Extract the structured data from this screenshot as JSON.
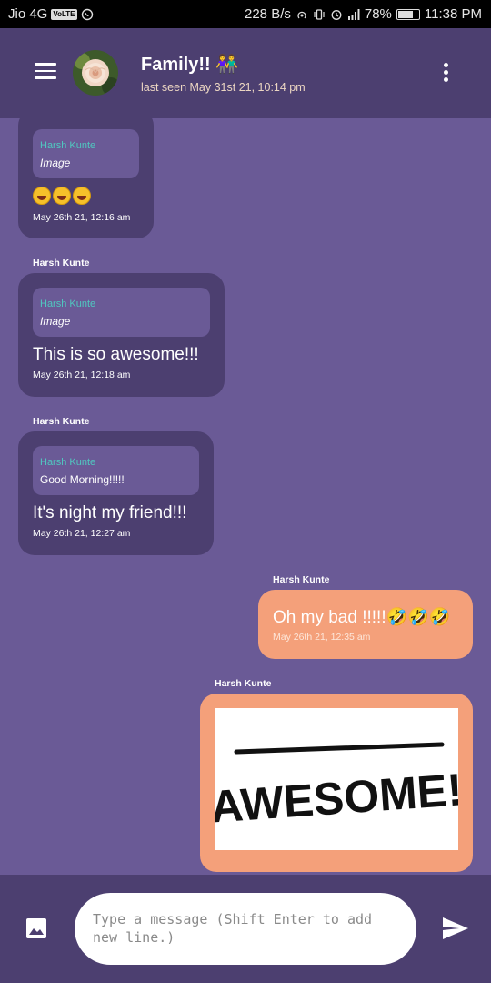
{
  "status_bar": {
    "carrier": "Jio 4G",
    "volte": "VoLTE",
    "speed": "228 B/s",
    "battery": "78%",
    "battery_level": 0.78,
    "time": "11:38 PM"
  },
  "header": {
    "title": "Family!! 👫",
    "subtitle": "last seen May 31st 21, 10:14 pm"
  },
  "messages": [
    {
      "direction": "incoming",
      "sender": "",
      "quote": {
        "name": "Harsh Kunte",
        "text": "Image"
      },
      "text": "😂😂😂",
      "time": "May 26th 21, 12:16 am"
    },
    {
      "direction": "incoming",
      "sender": "Harsh Kunte",
      "quote": {
        "name": "Harsh Kunte",
        "text": "Image"
      },
      "text": "This is so awesome!!!",
      "time": "May 26th 21, 12:18 am"
    },
    {
      "direction": "incoming",
      "sender": "Harsh Kunte",
      "quote": {
        "name": "Harsh Kunte",
        "text": "Good Morning!!!!!"
      },
      "text": "It's night my friend!!!",
      "time": "May 26th 21, 12:27 am"
    },
    {
      "direction": "outgoing",
      "sender": "Harsh Kunte",
      "text": "Oh my bad !!!!!🤣🤣🤣",
      "time": "May 26th 21, 12:35 am"
    },
    {
      "direction": "outgoing",
      "sender": "Harsh Kunte",
      "image_text": "AWESOME!"
    }
  ],
  "composer": {
    "placeholder": "Type a message (Shift Enter to add new line.)"
  },
  "colors": {
    "app_bar": "#4c3f70",
    "chat_background": "#6a5a96",
    "incoming_bubble": "#4c3f70",
    "outgoing_bubble": "#f4a07a",
    "quote_name": "#50c8c0"
  },
  "icons": {
    "menu": "hamburger-menu-icon",
    "more": "more-vertical-icon",
    "gallery": "image-icon",
    "send": "send-icon"
  }
}
